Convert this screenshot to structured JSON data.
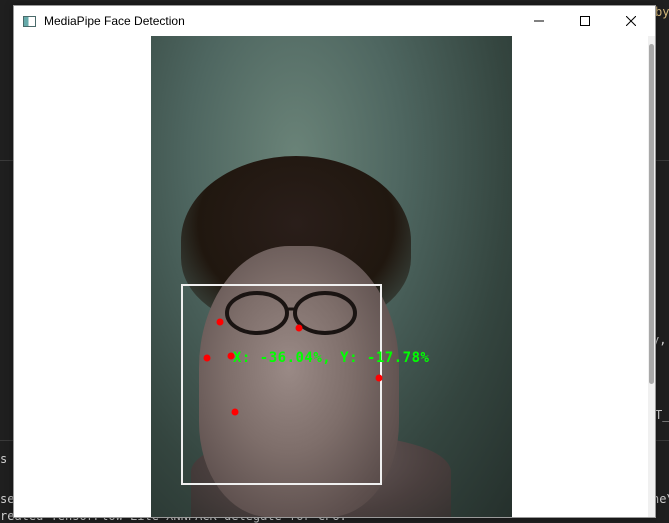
{
  "window": {
    "title": "MediaPipe Face Detection"
  },
  "overlay": {
    "coords_text": "X: -36.04%, Y: -17.78%",
    "box_color": "#f0f0f0",
    "landmark_color": "#ff0000",
    "text_color": "#00ff00"
  },
  "background": {
    "terminal_line": "reated TensorFlow Lite XNNPACK delegate for CPU.",
    "right_fragment_top": "by",
    "right_fragment_mid": "y,",
    "right_fragment_low": "T_",
    "left_fragment_1": "s",
    "left_fragment_2": "se",
    "right_fragment_bottom": "ne\\"
  },
  "icons": [
    "app-icon",
    "minimize-icon",
    "maximize-icon",
    "close-icon"
  ]
}
